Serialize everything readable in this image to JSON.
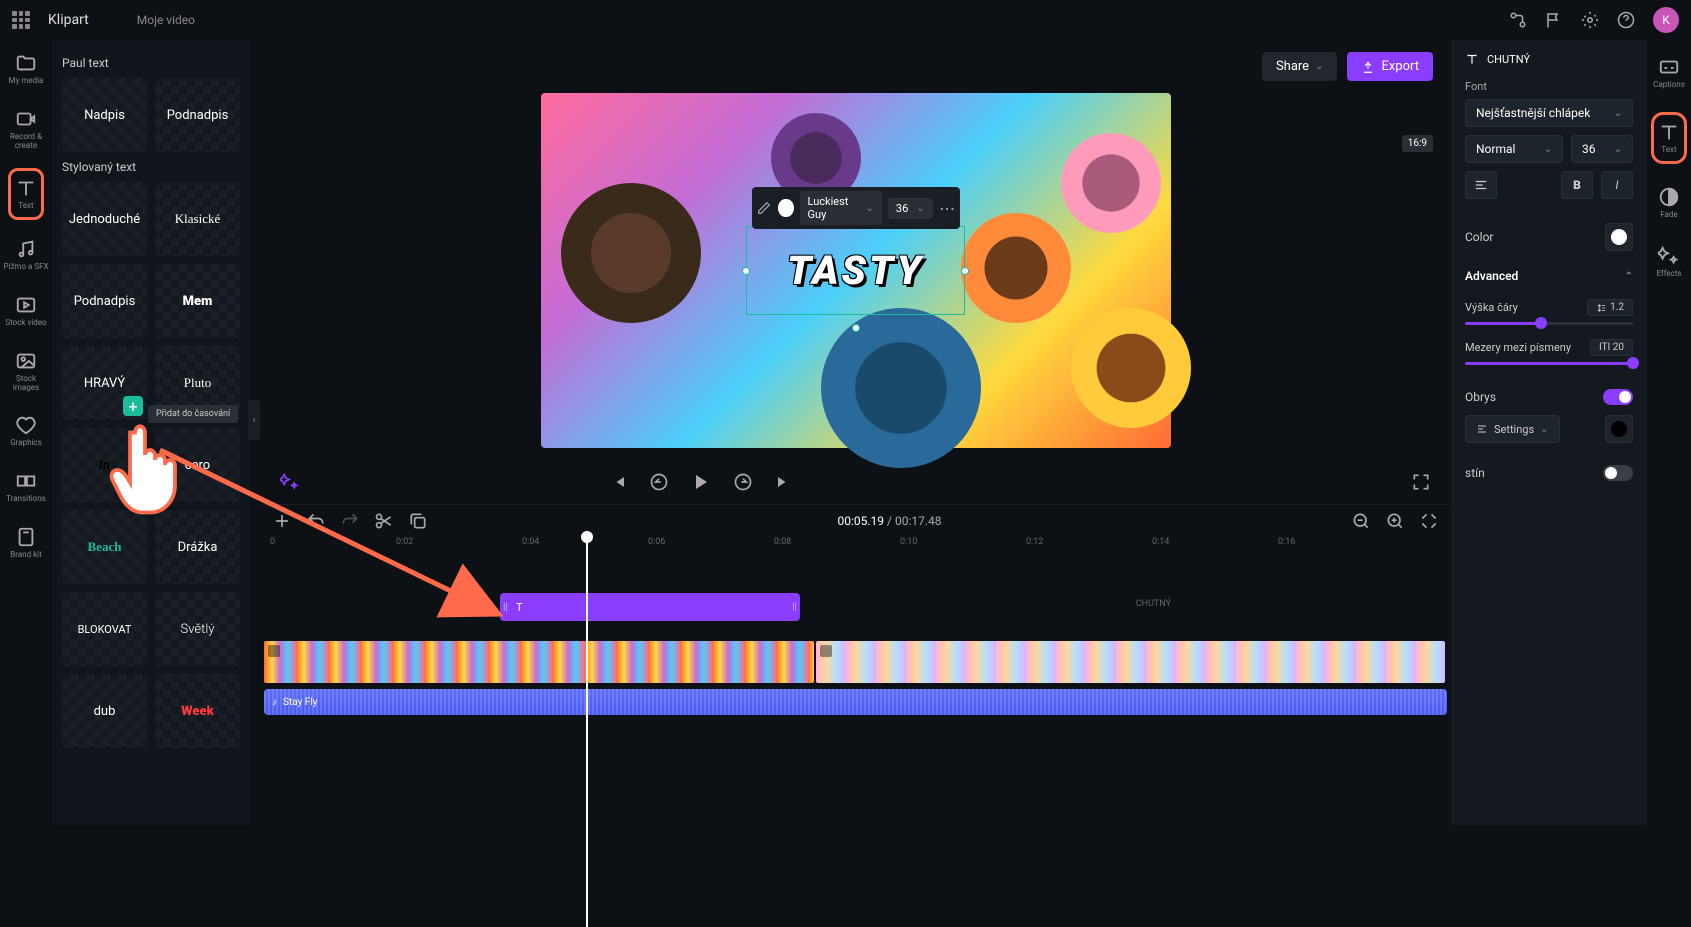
{
  "header": {
    "app_name": "Klipart",
    "tab_name": "Moje video",
    "avatar_initial": "K"
  },
  "left_rail": [
    {
      "key": "my-media",
      "label": "My media"
    },
    {
      "key": "record",
      "label": "Record & create"
    },
    {
      "key": "text",
      "label": "Text"
    },
    {
      "key": "audio",
      "label": "Pižmo a SFX"
    },
    {
      "key": "stock-video",
      "label": "Stock video"
    },
    {
      "key": "stock-images",
      "label": "Stock images"
    },
    {
      "key": "graphics",
      "label": "Graphics"
    },
    {
      "key": "transitions",
      "label": "Transitions"
    },
    {
      "key": "brand-kit",
      "label": "Brand kit"
    }
  ],
  "presets": {
    "section1_title": "Paul text",
    "section1": [
      "Nadpis",
      "Podnadpis"
    ],
    "section2_title": "Stylovaný text",
    "section2": [
      "Jednoduché",
      "Klasické",
      "Podnadpis",
      "Mem",
      "HRAVÝ",
      "Pluto",
      "In",
      "cero",
      "Beach",
      "Drážka",
      "BLOKOVAT",
      "Světlý",
      "dub",
      "Week"
    ],
    "tooltip": "Přidat do časování"
  },
  "canvas": {
    "share_label": "Share",
    "export_label": "Export",
    "aspect": "16:9",
    "text_value": "TASTY",
    "toolbar_font": "Luckiest Guy",
    "toolbar_size": "36"
  },
  "timeline": {
    "current": "00:05.19",
    "total": "00:17.48",
    "ticks": [
      "0",
      "0:02",
      "0:04",
      "0:06",
      "0:08",
      "0:10",
      "0:12",
      "0:14",
      "0:16"
    ],
    "text_clip_label": "T",
    "far_label": "CHUTNÝ",
    "audio_label": "Stay Fly"
  },
  "right_rail": [
    {
      "key": "captions",
      "label": "Captions"
    },
    {
      "key": "text",
      "label": "Text"
    },
    {
      "key": "fade",
      "label": "Fade"
    },
    {
      "key": "effects",
      "label": "Effects"
    }
  ],
  "props": {
    "header": "CHUTNÝ",
    "font_label": "Font",
    "font_family": "Nejšťastnější chlápek",
    "font_weight": "Normal",
    "font_size": "36",
    "color_label": "Color",
    "advanced_label": "Advanced",
    "line_height_label": "Výška čáry",
    "line_height_value": "1.2",
    "letter_spacing_label": "Mezery mezi písmeny",
    "letter_spacing_value": "ITI 20",
    "outline_label": "Obrys",
    "settings_label": "Settings",
    "shadow_label": "stín"
  }
}
